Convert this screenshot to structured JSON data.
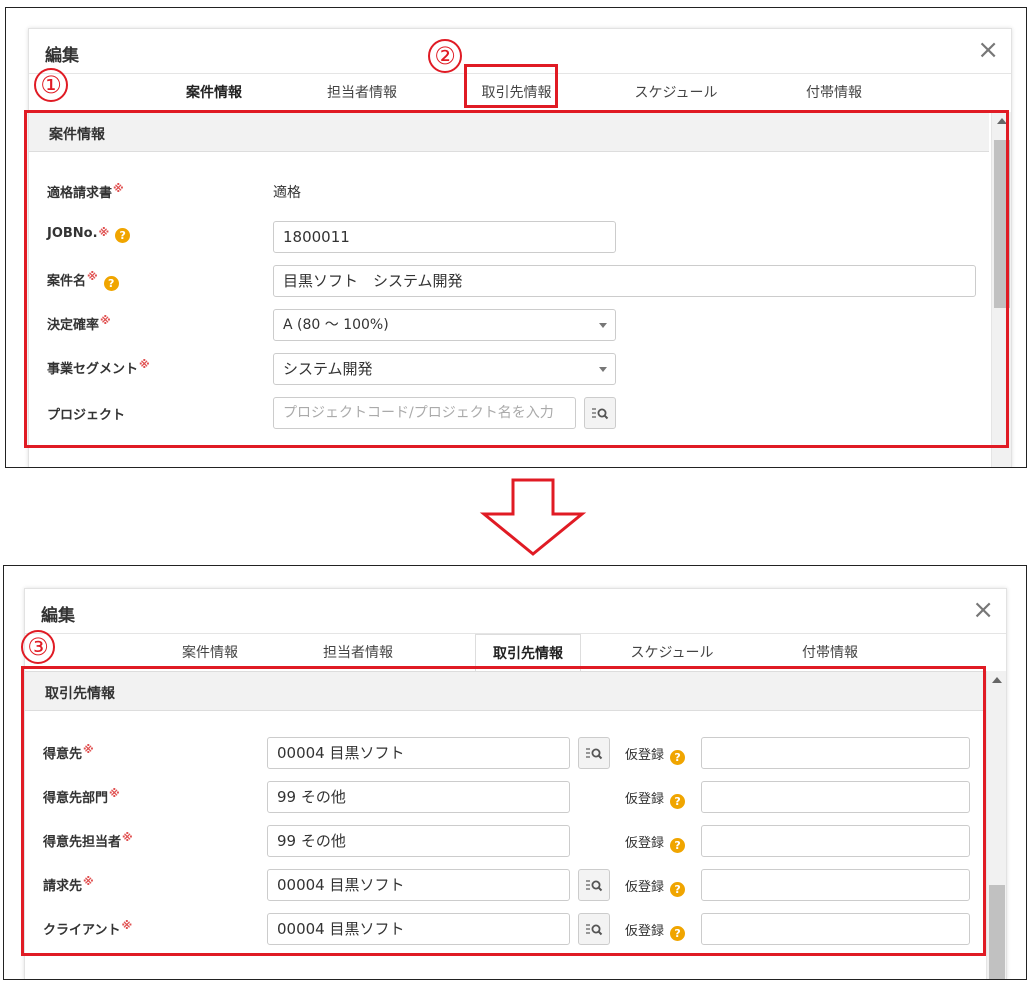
{
  "modal": {
    "title": "編集",
    "close_icon": "×"
  },
  "tabs": [
    "案件情報",
    "担当者情報",
    "取引先情報",
    "スケジュール",
    "付帯情報"
  ],
  "annotations": {
    "one": "①",
    "two": "②",
    "three": "③"
  },
  "top_panel": {
    "section_title": "案件情報",
    "required_mark": "※",
    "help_mark": "?",
    "fields": {
      "tekikaku": {
        "label": "適格請求書",
        "value": "適格"
      },
      "jobno": {
        "label": "JOBNo.",
        "value": "1800011"
      },
      "anken": {
        "label": "案件名",
        "value": "目黒ソフト　システム開発"
      },
      "kakuritsu": {
        "label": "決定確率",
        "value": "A (80 ～ 100%)"
      },
      "segment": {
        "label": "事業セグメント",
        "value": "システム開発"
      },
      "project": {
        "label": "プロジェクト",
        "placeholder": "プロジェクトコード/プロジェクト名を入力"
      }
    }
  },
  "bottom_panel": {
    "section_title": "取引先情報",
    "kari_label": "仮登録",
    "rows": [
      {
        "label": "得意先",
        "value": "00004 目黒ソフト"
      },
      {
        "label": "得意先部門",
        "value": "99 その他"
      },
      {
        "label": "得意先担当者",
        "value": "99 その他"
      },
      {
        "label": "請求先",
        "value": "00004 目黒ソフト"
      },
      {
        "label": "クライアント",
        "value": "00004 目黒ソフト"
      }
    ]
  },
  "colors": {
    "annotation_red": "#e01b24",
    "help_orange": "#f0a500",
    "required_red": "#e05050"
  }
}
